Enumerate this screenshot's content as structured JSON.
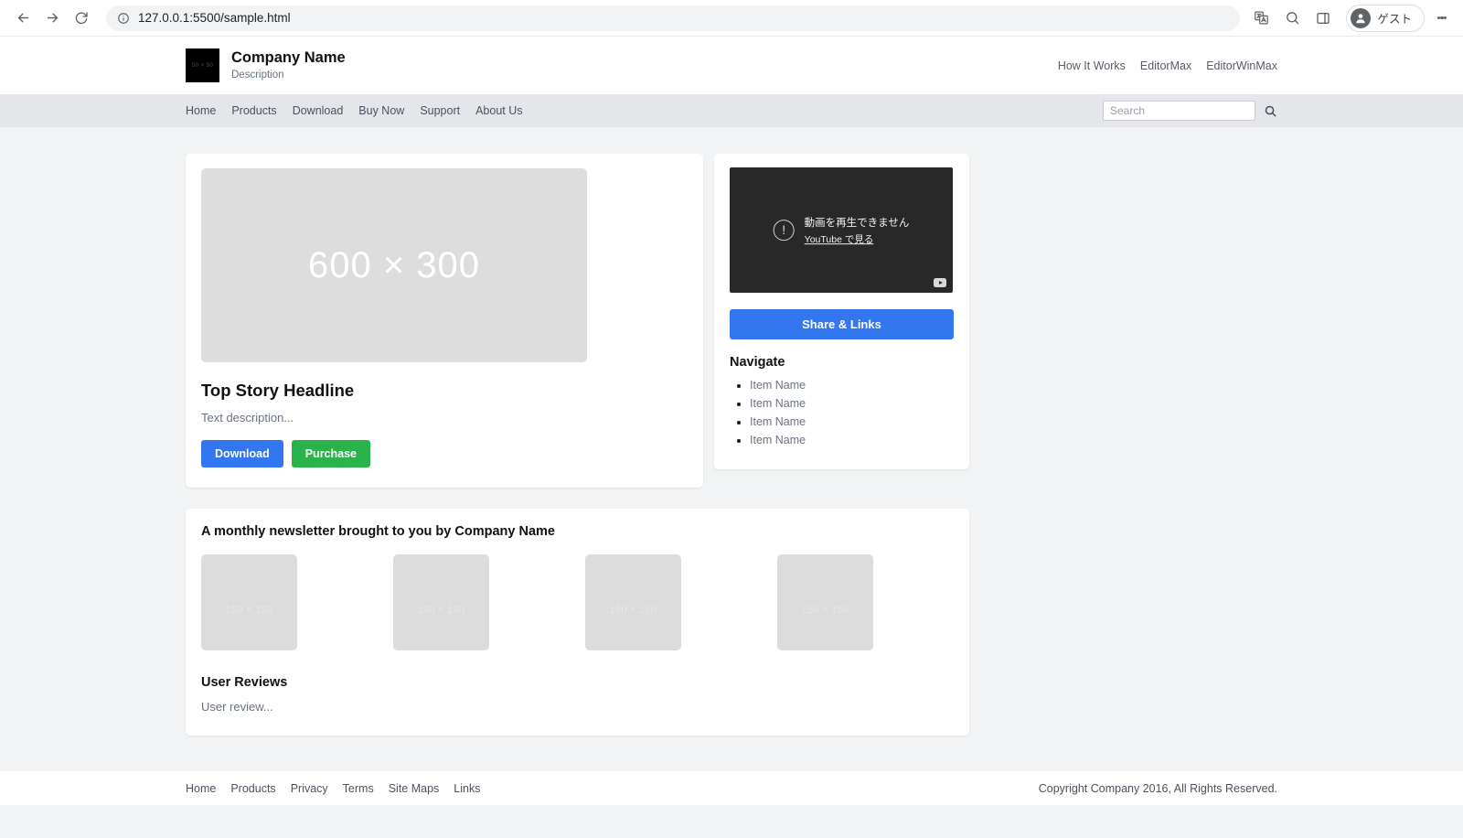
{
  "browser": {
    "url": "127.0.0.1:5500/sample.html",
    "back_icon": "back-arrow-icon",
    "forward_icon": "forward-arrow-icon",
    "reload_icon": "reload-icon",
    "info_icon": "page-info-icon",
    "translate_icon": "translate-icon",
    "zoom_icon": "search-zoom-icon",
    "side_panel_icon": "side-panel-icon",
    "profile_name": "ゲスト",
    "menu_icon": "kebab-menu-icon"
  },
  "header": {
    "logo_text": "50 × 50",
    "company_name": "Company Name",
    "description": "Description",
    "top_links": [
      {
        "label": "How It Works"
      },
      {
        "label": "EditorMax"
      },
      {
        "label": "EditorWinMax"
      }
    ]
  },
  "navbar": {
    "items": [
      {
        "label": "Home"
      },
      {
        "label": "Products"
      },
      {
        "label": "Download"
      },
      {
        "label": "Buy Now"
      },
      {
        "label": "Support"
      },
      {
        "label": "About Us"
      }
    ],
    "search_placeholder": "Search",
    "search_value": "",
    "search_icon": "search-icon"
  },
  "main": {
    "hero_placeholder": "600 × 300",
    "story_title": "Top Story Headline",
    "story_description": "Text description...",
    "download_label": "Download",
    "purchase_label": "Purchase"
  },
  "sidebar": {
    "video_error_title": "動画を再生できません",
    "video_error_link": "YouTube で見る",
    "video_error_icon": "warning-circle-icon",
    "youtube_badge_icon": "youtube-logo-icon",
    "share_label": "Share & Links",
    "navigate_title": "Navigate",
    "navigate_items": [
      {
        "label": "Item Name"
      },
      {
        "label": "Item Name"
      },
      {
        "label": "Item Name"
      },
      {
        "label": "Item Name"
      }
    ]
  },
  "newsletter": {
    "title": "A monthly newsletter brought to you by Company Name",
    "thumbs": [
      {
        "label": "150 × 150"
      },
      {
        "label": "150 × 150"
      },
      {
        "label": "150 × 150"
      },
      {
        "label": "150 × 150"
      }
    ],
    "reviews_title": "User Reviews",
    "reviews_text": "User review..."
  },
  "footer": {
    "links": [
      {
        "label": "Home"
      },
      {
        "label": "Products"
      },
      {
        "label": "Privacy"
      },
      {
        "label": "Terms"
      },
      {
        "label": "Site Maps"
      },
      {
        "label": "Links"
      }
    ],
    "copyright": "Copyright Company 2016, All Rights Reserved."
  },
  "colors": {
    "accent_blue": "#3276f0",
    "accent_green": "#2ab34a",
    "page_bg": "#f1f3f4",
    "navbar_bg": "#e4e6e9",
    "placeholder_gray": "#dcdcdc"
  }
}
